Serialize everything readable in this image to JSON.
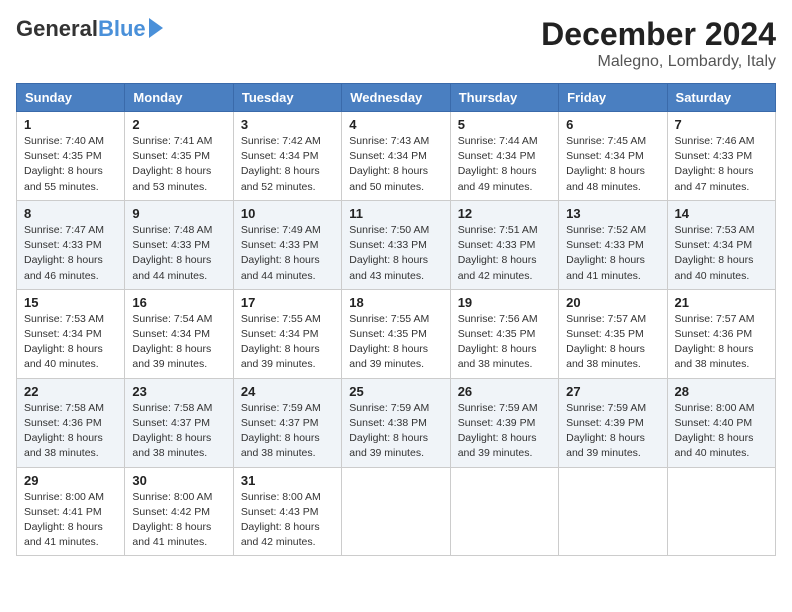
{
  "header": {
    "logo_general": "General",
    "logo_blue": "Blue",
    "month_title": "December 2024",
    "location": "Malegno, Lombardy, Italy"
  },
  "weekdays": [
    "Sunday",
    "Monday",
    "Tuesday",
    "Wednesday",
    "Thursday",
    "Friday",
    "Saturday"
  ],
  "weeks": [
    [
      {
        "day": "1",
        "sunrise": "7:40 AM",
        "sunset": "4:35 PM",
        "daylight": "8 hours and 55 minutes."
      },
      {
        "day": "2",
        "sunrise": "7:41 AM",
        "sunset": "4:35 PM",
        "daylight": "8 hours and 53 minutes."
      },
      {
        "day": "3",
        "sunrise": "7:42 AM",
        "sunset": "4:34 PM",
        "daylight": "8 hours and 52 minutes."
      },
      {
        "day": "4",
        "sunrise": "7:43 AM",
        "sunset": "4:34 PM",
        "daylight": "8 hours and 50 minutes."
      },
      {
        "day": "5",
        "sunrise": "7:44 AM",
        "sunset": "4:34 PM",
        "daylight": "8 hours and 49 minutes."
      },
      {
        "day": "6",
        "sunrise": "7:45 AM",
        "sunset": "4:34 PM",
        "daylight": "8 hours and 48 minutes."
      },
      {
        "day": "7",
        "sunrise": "7:46 AM",
        "sunset": "4:33 PM",
        "daylight": "8 hours and 47 minutes."
      }
    ],
    [
      {
        "day": "8",
        "sunrise": "7:47 AM",
        "sunset": "4:33 PM",
        "daylight": "8 hours and 46 minutes."
      },
      {
        "day": "9",
        "sunrise": "7:48 AM",
        "sunset": "4:33 PM",
        "daylight": "8 hours and 44 minutes."
      },
      {
        "day": "10",
        "sunrise": "7:49 AM",
        "sunset": "4:33 PM",
        "daylight": "8 hours and 44 minutes."
      },
      {
        "day": "11",
        "sunrise": "7:50 AM",
        "sunset": "4:33 PM",
        "daylight": "8 hours and 43 minutes."
      },
      {
        "day": "12",
        "sunrise": "7:51 AM",
        "sunset": "4:33 PM",
        "daylight": "8 hours and 42 minutes."
      },
      {
        "day": "13",
        "sunrise": "7:52 AM",
        "sunset": "4:33 PM",
        "daylight": "8 hours and 41 minutes."
      },
      {
        "day": "14",
        "sunrise": "7:53 AM",
        "sunset": "4:34 PM",
        "daylight": "8 hours and 40 minutes."
      }
    ],
    [
      {
        "day": "15",
        "sunrise": "7:53 AM",
        "sunset": "4:34 PM",
        "daylight": "8 hours and 40 minutes."
      },
      {
        "day": "16",
        "sunrise": "7:54 AM",
        "sunset": "4:34 PM",
        "daylight": "8 hours and 39 minutes."
      },
      {
        "day": "17",
        "sunrise": "7:55 AM",
        "sunset": "4:34 PM",
        "daylight": "8 hours and 39 minutes."
      },
      {
        "day": "18",
        "sunrise": "7:55 AM",
        "sunset": "4:35 PM",
        "daylight": "8 hours and 39 minutes."
      },
      {
        "day": "19",
        "sunrise": "7:56 AM",
        "sunset": "4:35 PM",
        "daylight": "8 hours and 38 minutes."
      },
      {
        "day": "20",
        "sunrise": "7:57 AM",
        "sunset": "4:35 PM",
        "daylight": "8 hours and 38 minutes."
      },
      {
        "day": "21",
        "sunrise": "7:57 AM",
        "sunset": "4:36 PM",
        "daylight": "8 hours and 38 minutes."
      }
    ],
    [
      {
        "day": "22",
        "sunrise": "7:58 AM",
        "sunset": "4:36 PM",
        "daylight": "8 hours and 38 minutes."
      },
      {
        "day": "23",
        "sunrise": "7:58 AM",
        "sunset": "4:37 PM",
        "daylight": "8 hours and 38 minutes."
      },
      {
        "day": "24",
        "sunrise": "7:59 AM",
        "sunset": "4:37 PM",
        "daylight": "8 hours and 38 minutes."
      },
      {
        "day": "25",
        "sunrise": "7:59 AM",
        "sunset": "4:38 PM",
        "daylight": "8 hours and 39 minutes."
      },
      {
        "day": "26",
        "sunrise": "7:59 AM",
        "sunset": "4:39 PM",
        "daylight": "8 hours and 39 minutes."
      },
      {
        "day": "27",
        "sunrise": "7:59 AM",
        "sunset": "4:39 PM",
        "daylight": "8 hours and 39 minutes."
      },
      {
        "day": "28",
        "sunrise": "8:00 AM",
        "sunset": "4:40 PM",
        "daylight": "8 hours and 40 minutes."
      }
    ],
    [
      {
        "day": "29",
        "sunrise": "8:00 AM",
        "sunset": "4:41 PM",
        "daylight": "8 hours and 41 minutes."
      },
      {
        "day": "30",
        "sunrise": "8:00 AM",
        "sunset": "4:42 PM",
        "daylight": "8 hours and 41 minutes."
      },
      {
        "day": "31",
        "sunrise": "8:00 AM",
        "sunset": "4:43 PM",
        "daylight": "8 hours and 42 minutes."
      },
      null,
      null,
      null,
      null
    ]
  ],
  "labels": {
    "sunrise": "Sunrise:",
    "sunset": "Sunset:",
    "daylight": "Daylight:"
  }
}
